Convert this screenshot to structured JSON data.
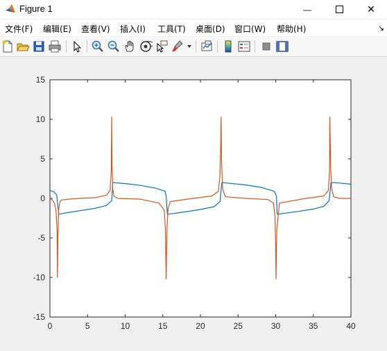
{
  "window": {
    "title": "Figure 1",
    "minimize_glyph": "—",
    "close_glyph": "✕"
  },
  "menu": {
    "items": [
      "文件(F)",
      "编辑(E)",
      "查看(V)",
      "插入(I)",
      "工具(T)",
      "桌面(D)",
      "窗口(W)",
      "帮助(H)"
    ],
    "overflow_glyph": "↘"
  },
  "toolbar": {
    "icons": [
      "new-figure-icon",
      "open-file-icon",
      "save-icon",
      "print-icon",
      "select-arrow-icon",
      "zoom-in-icon",
      "zoom-out-icon",
      "pan-hand-icon",
      "rotate-3d-icon",
      "data-cursor-icon",
      "brush-icon",
      "link-plot-icon",
      "colorbar-icon",
      "legend-icon",
      "hide-plot-tools-icon",
      "show-plot-tools-icon"
    ]
  },
  "colors": {
    "series1": "#0072bd",
    "series2": "#d95319"
  },
  "chart_data": {
    "type": "line",
    "title": "",
    "xlabel": "",
    "ylabel": "",
    "xlim": [
      0,
      40
    ],
    "ylim": [
      -15,
      15
    ],
    "xticks": [
      0,
      5,
      10,
      15,
      20,
      25,
      30,
      35,
      40
    ],
    "yticks": [
      -15,
      -10,
      -5,
      0,
      5,
      10,
      15
    ],
    "grid": false,
    "series": [
      {
        "color": "#0072bd",
        "x": [
          0,
          0.5,
          0.9,
          1.05,
          1.2,
          2,
          4,
          6,
          7.5,
          8.2,
          8.3,
          8.35,
          10,
          12,
          14,
          15.3,
          15.45,
          15.6,
          16.5,
          18,
          20,
          21.8,
          22.6,
          22.75,
          22.85,
          24,
          26,
          28,
          29.8,
          30.1,
          30.2,
          31,
          33,
          35,
          36.4,
          37.1,
          37.25,
          37.35,
          38.5,
          40
        ],
        "y": [
          1.0,
          0.85,
          0.4,
          -1.0,
          -2.0,
          -1.85,
          -1.55,
          -1.25,
          -0.9,
          -0.3,
          1.2,
          2.0,
          1.88,
          1.65,
          1.3,
          0.9,
          0.3,
          -2.0,
          -1.9,
          -1.7,
          -1.4,
          -1.05,
          -0.4,
          1.1,
          2.0,
          1.9,
          1.7,
          1.4,
          0.9,
          0.3,
          -2.0,
          -1.9,
          -1.65,
          -1.35,
          -1.0,
          -0.3,
          1.1,
          2.0,
          1.95,
          1.8
        ]
      },
      {
        "color": "#d95319",
        "x": [
          0,
          0.3,
          0.6,
          0.8,
          0.95,
          1.0,
          1.05,
          1.15,
          1.3,
          1.5,
          3,
          6,
          7.5,
          8.0,
          8.15,
          8.2,
          8.25,
          8.35,
          8.5,
          9,
          12,
          14.5,
          15.2,
          15.35,
          15.45,
          15.55,
          15.7,
          16,
          19,
          21.5,
          22.4,
          22.6,
          22.7,
          22.75,
          22.8,
          22.95,
          23.3,
          26,
          29,
          29.7,
          29.9,
          30.0,
          30.05,
          30.15,
          30.5,
          34,
          36.4,
          37.0,
          37.15,
          37.2,
          37.3,
          37.45,
          37.7,
          38.5,
          40
        ],
        "y": [
          0.0,
          -0.2,
          -0.6,
          -1.5,
          -4.0,
          -10.0,
          -5.0,
          -1.5,
          -0.5,
          -0.2,
          -0.05,
          0.1,
          0.4,
          1.0,
          3.5,
          10.3,
          4.0,
          1.2,
          0.3,
          0.0,
          -0.1,
          -0.6,
          -1.5,
          -4.0,
          -10.2,
          -4.0,
          -1.3,
          -0.4,
          0.0,
          0.3,
          0.9,
          3.0,
          7.0,
          10.3,
          5.0,
          1.2,
          0.2,
          0.0,
          -0.15,
          -0.6,
          -2.0,
          -6.0,
          -10.2,
          -4.0,
          -0.6,
          0.0,
          0.3,
          1.0,
          3.5,
          10.3,
          4.0,
          1.2,
          0.2,
          0.0,
          0.0
        ]
      }
    ]
  }
}
